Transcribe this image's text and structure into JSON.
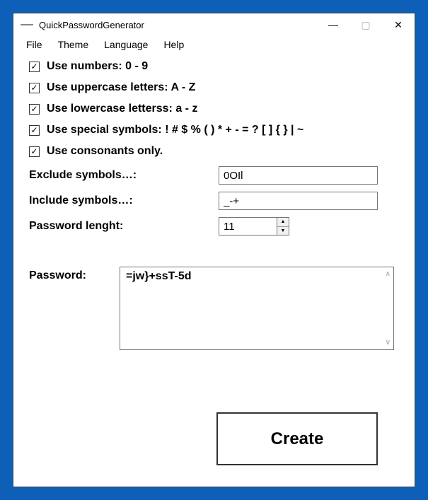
{
  "window": {
    "title": "QuickPasswordGenerator"
  },
  "menubar": {
    "file": "File",
    "theme": "Theme",
    "language": "Language",
    "help": "Help"
  },
  "options": {
    "numbers": {
      "checked": true,
      "label": "Use numbers: 0 - 9"
    },
    "uppercase": {
      "checked": true,
      "label": "Use uppercase letters: A - Z"
    },
    "lowercase": {
      "checked": true,
      "label": "Use lowercase letterss: a - z"
    },
    "special": {
      "checked": true,
      "label": "Use special symbols: ! # $ % ( ) * + - = ? [ ] { } | ~"
    },
    "consonants": {
      "checked": true,
      "label": "Use consonants only."
    }
  },
  "fields": {
    "exclude": {
      "label": "Exclude symbols…:",
      "value": "0OIl"
    },
    "include": {
      "label": "Include symbols…:",
      "value": "_-+"
    },
    "length": {
      "label": "Password lenght:",
      "value": "11"
    }
  },
  "password": {
    "label": "Password:",
    "value": "=jw}+ssT-5d"
  },
  "buttons": {
    "create": "Create"
  },
  "glyphs": {
    "check": "✓",
    "minimize": "—",
    "close": "✕",
    "up": "▲",
    "down": "▼",
    "maximize": "▢",
    "scrollup": "∧",
    "scrolldown": "∨"
  }
}
